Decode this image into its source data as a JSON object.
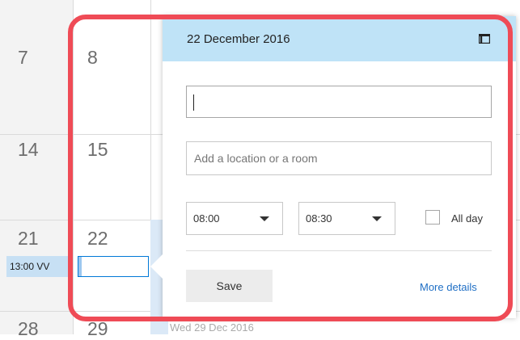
{
  "calendar": {
    "days": [
      "7",
      "8",
      "14",
      "15",
      "21",
      "22",
      "28",
      "29"
    ],
    "event_chip": "13:00 VV",
    "hint_text": "Wed 29 Dec 2016"
  },
  "popover": {
    "date": "22 December 2016",
    "title_value": "",
    "location_placeholder": "Add a location or a room",
    "start_time": "08:00",
    "end_time": "08:30",
    "all_day_label": "All day",
    "all_day_checked": false,
    "save_label": "Save",
    "more_details_label": "More details"
  },
  "colors": {
    "header_bg": "#bfe3f7",
    "highlight": "#ef4b56",
    "link": "#1f6fc5",
    "event_bg": "#c7e0f4"
  },
  "icons": {
    "popout": "popout-icon",
    "dropdown": "chevron-down-icon"
  }
}
